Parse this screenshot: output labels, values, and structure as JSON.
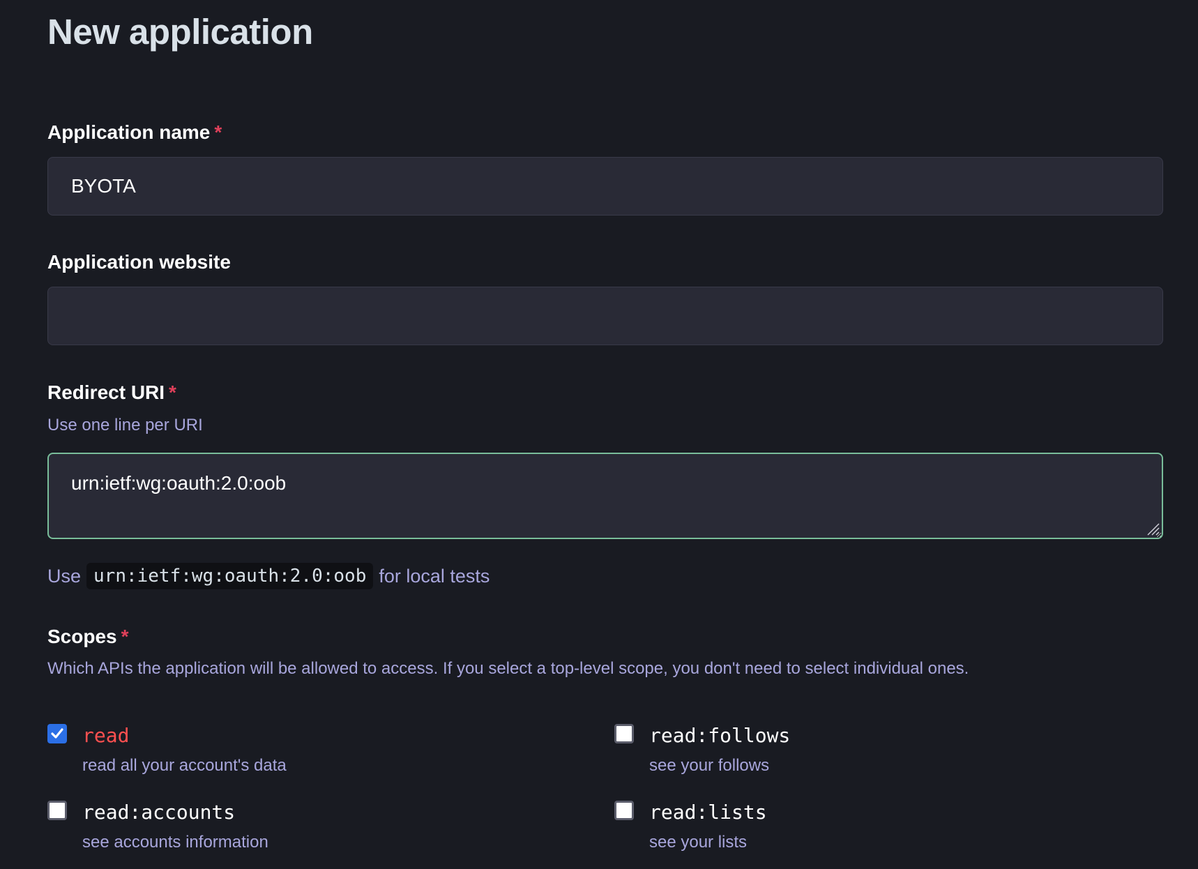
{
  "page": {
    "title": "New application"
  },
  "fields": {
    "name": {
      "label": "Application name",
      "required_mark": "*",
      "value": "BYOTA"
    },
    "website": {
      "label": "Application website",
      "value": ""
    },
    "redirect": {
      "label": "Redirect URI",
      "required_mark": "*",
      "hint": "Use one line per URI",
      "value": "urn:ietf:wg:oauth:2.0:oob",
      "local_hint_prefix": "Use",
      "local_hint_code": "urn:ietf:wg:oauth:2.0:oob",
      "local_hint_suffix": "for local tests"
    },
    "scopes": {
      "label": "Scopes",
      "required_mark": "*",
      "hint": "Which APIs the application will be allowed to access. If you select a top-level scope, you don't need to select individual ones.",
      "items": [
        {
          "name": "read",
          "description": "read all your account's data",
          "checked": true
        },
        {
          "name": "read:follows",
          "description": "see your follows",
          "checked": false
        },
        {
          "name": "read:accounts",
          "description": "see accounts information",
          "checked": false
        },
        {
          "name": "read:lists",
          "description": "see your lists",
          "checked": false
        }
      ]
    }
  },
  "colors": {
    "background": "#191b22",
    "input_bg": "#292a36",
    "focus_border": "#79bd9a",
    "required": "#df405a",
    "hint": "#a8a6dc",
    "checkbox_checked": "#2b6fe6",
    "danger_scope": "#ff5050"
  },
  "icons": {
    "check": "check-icon",
    "resize": "resize-grip-icon"
  }
}
